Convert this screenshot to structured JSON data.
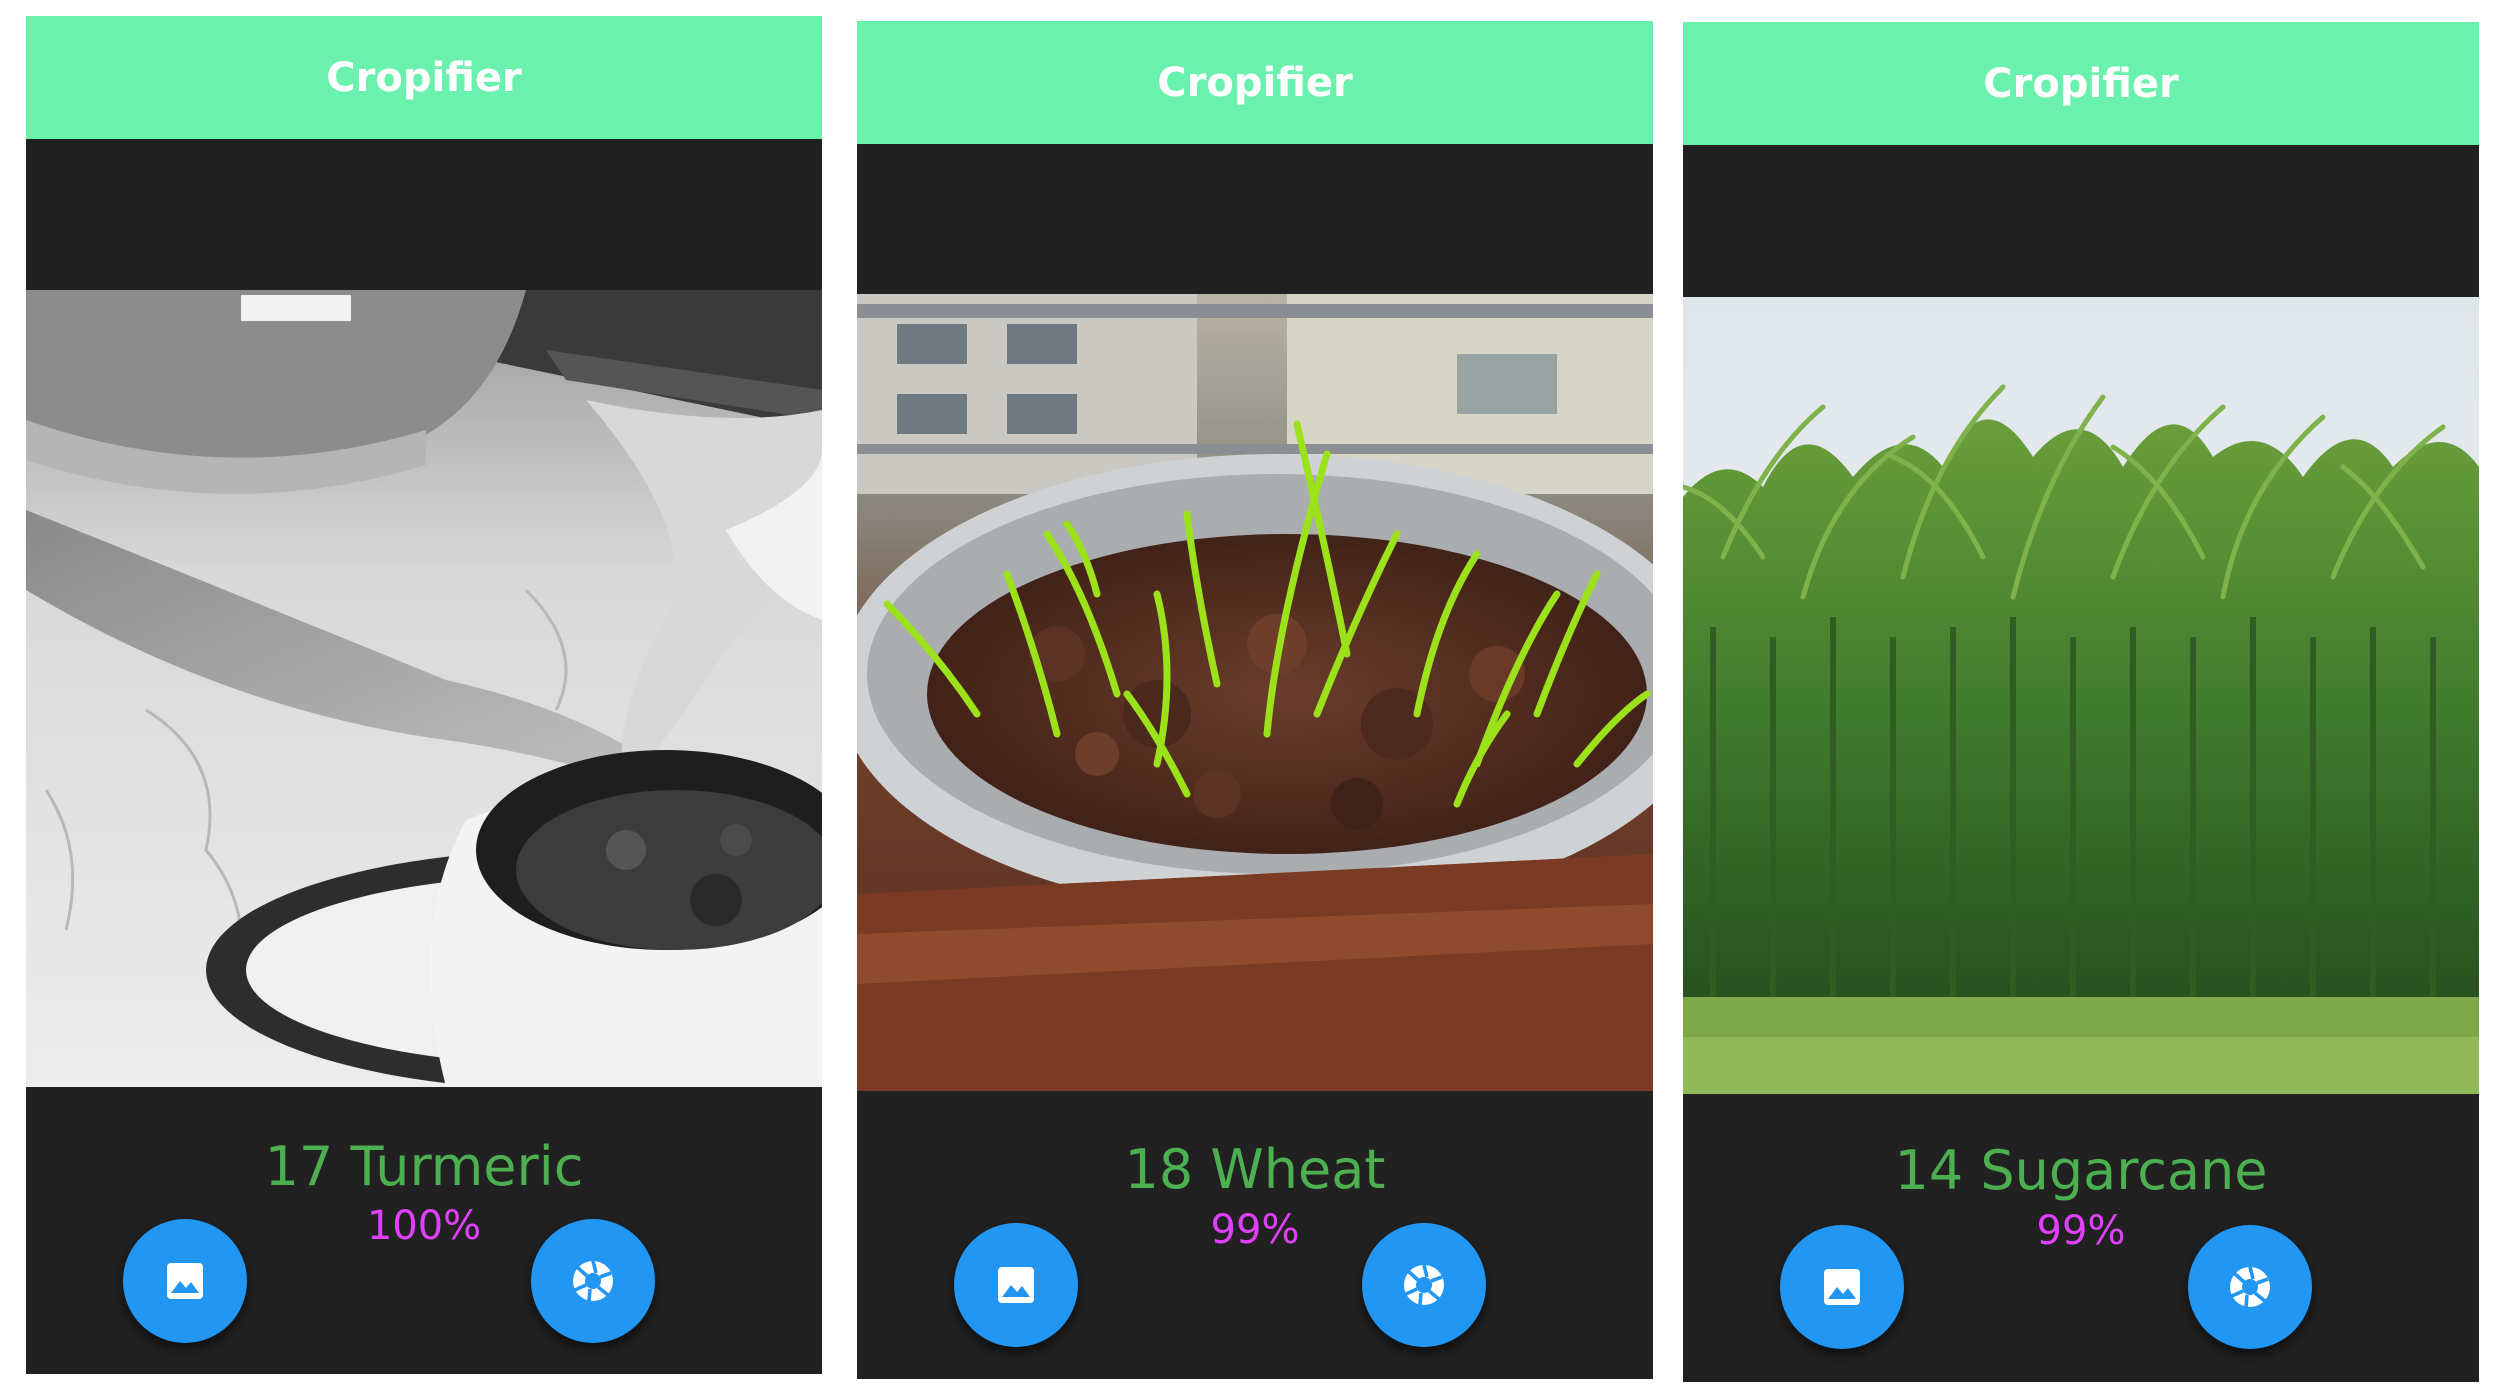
{
  "screens": [
    {
      "app_title": "Cropifier",
      "prediction_label": "17 Turmeric",
      "confidence": "100%",
      "image_subject": "turmeric-plant-photo-grayscale",
      "gallery_icon": "image-icon",
      "camera_icon": "aperture-icon"
    },
    {
      "app_title": "Cropifier",
      "prediction_label": "18 Wheat",
      "confidence": "99%",
      "image_subject": "wheat-sprouts-photo",
      "gallery_icon": "image-icon",
      "camera_icon": "aperture-icon"
    },
    {
      "app_title": "Cropifier",
      "prediction_label": "14 Sugarcane",
      "confidence": "99%",
      "image_subject": "sugarcane-field-photo",
      "gallery_icon": "image-icon",
      "camera_icon": "aperture-icon"
    }
  ],
  "colors": {
    "appbar": "#6bf1ae",
    "background": "#212121",
    "label": "#4caf50",
    "confidence": "#e040fb",
    "fab": "#2196f3"
  }
}
